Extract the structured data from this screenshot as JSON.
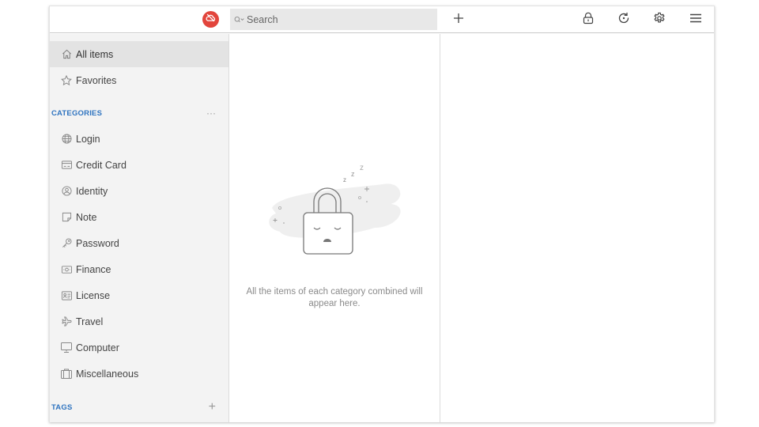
{
  "topbar": {
    "sync_status_icon": "cloud-off-icon",
    "sync_status_color": "#e2453c",
    "search": {
      "placeholder": "Search",
      "value": ""
    },
    "actions": [
      {
        "name": "add",
        "icon": "plus-icon",
        "glyph": "+"
      },
      {
        "name": "lock",
        "icon": "lock-icon"
      },
      {
        "name": "sync",
        "icon": "sync-icon"
      },
      {
        "name": "settings",
        "icon": "gear-icon"
      },
      {
        "name": "menu",
        "icon": "hamburger-menu-icon"
      }
    ]
  },
  "sidebar": {
    "top_items": [
      {
        "label": "All items",
        "icon": "home-icon",
        "active": true
      },
      {
        "label": "Favorites",
        "icon": "star-icon",
        "active": false
      }
    ],
    "categories": {
      "title": "CATEGORIES",
      "action": "···",
      "items": [
        {
          "label": "Login",
          "icon": "globe-icon"
        },
        {
          "label": "Credit Card",
          "icon": "credit-card-icon"
        },
        {
          "label": "Identity",
          "icon": "identity-icon"
        },
        {
          "label": "Note",
          "icon": "note-icon"
        },
        {
          "label": "Password",
          "icon": "key-icon"
        },
        {
          "label": "Finance",
          "icon": "money-icon"
        },
        {
          "label": "License",
          "icon": "license-icon"
        },
        {
          "label": "Travel",
          "icon": "airplane-icon"
        },
        {
          "label": "Computer",
          "icon": "monitor-icon"
        },
        {
          "label": "Miscellaneous",
          "icon": "briefcase-icon"
        }
      ]
    },
    "tags": {
      "title": "TAGS",
      "action": "+"
    }
  },
  "list_pane": {
    "empty_message": "All the items of each category combined will appear here.",
    "illustration": "sleeping-lock-illustration",
    "zzz": [
      "z",
      "z",
      "z"
    ]
  },
  "colors": {
    "accent": "#2f74c0",
    "sidebar_bg": "#f3f3f3",
    "active_item_bg": "#e3e3e3",
    "search_bg": "#e8e8e8"
  }
}
